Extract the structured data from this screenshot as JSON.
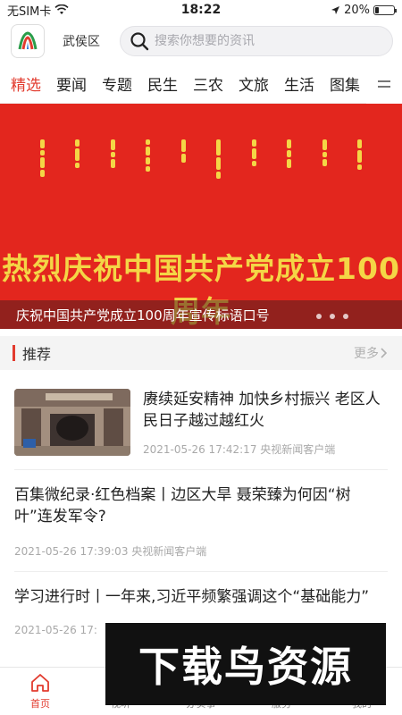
{
  "status_bar": {
    "carrier": "无SIM卡",
    "time": "18:22",
    "battery": "20%",
    "battery_level": 0.2
  },
  "header": {
    "region": "武侯区",
    "search_placeholder": "搜索你想要的资讯"
  },
  "tabs": [
    {
      "label": "精选",
      "active": true
    },
    {
      "label": "要闻"
    },
    {
      "label": "专题"
    },
    {
      "label": "民生"
    },
    {
      "label": "三农"
    },
    {
      "label": "文旅"
    },
    {
      "label": "生活"
    },
    {
      "label": "图集"
    }
  ],
  "banner": {
    "headline": "热烈庆祝中国共产党成立100周年",
    "caption": "庆祝中国共产党成立100周年宣传标语口号",
    "colors": {
      "background": "#e3261e",
      "text": "#f4d646"
    }
  },
  "section": {
    "title": "推荐",
    "more": "更多"
  },
  "news": [
    {
      "title": "赓续延安精神 加快乡村振兴 老区人民日子越过越红火",
      "meta": "2021-05-26 17:42:17 央视新闻客户端",
      "has_image": true
    },
    {
      "title": "百集微纪录·红色档案丨边区大旱 聂荣臻为何因“树叶”连发军令?",
      "meta": "2021-05-26 17:39:03 央视新闻客户端",
      "has_image": false
    },
    {
      "title": "学习进行时丨一年来,习近平频繁强调这个“基础能力”",
      "meta": "2021-05-26 17:",
      "has_image": false
    }
  ],
  "tabbar": [
    {
      "label": "首页",
      "icon": "home-icon",
      "active": true
    },
    {
      "label": "视听",
      "icon": "video-icon"
    },
    {
      "label": "办实事",
      "icon": "service-icon"
    },
    {
      "label": "服务",
      "icon": "grid-icon"
    },
    {
      "label": "我的",
      "icon": "user-icon"
    }
  ],
  "watermark": {
    "text": "下载鸟资源"
  },
  "accent_color": "#e23b2e"
}
